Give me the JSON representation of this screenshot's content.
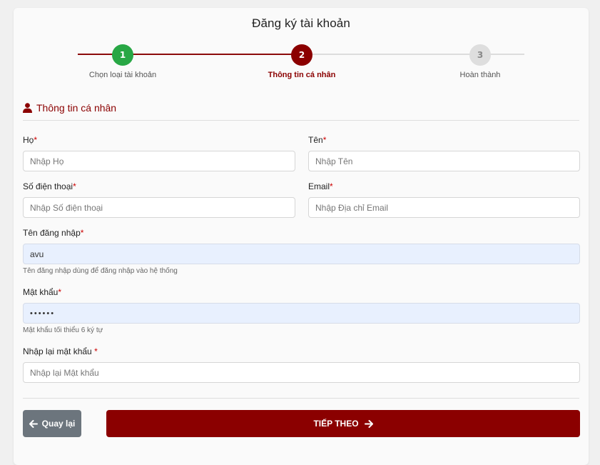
{
  "page": {
    "title": "Đăng ký tài khoản"
  },
  "stepper": {
    "steps": [
      {
        "number": "1",
        "label": "Chọn loại tài khoản",
        "state": "done"
      },
      {
        "number": "2",
        "label": "Thông tin cá nhân",
        "state": "active"
      },
      {
        "number": "3",
        "label": "Hoàn thành",
        "state": "pending"
      }
    ]
  },
  "section": {
    "title": "Thông tin cá nhân",
    "icon": "user-icon"
  },
  "form": {
    "last_name": {
      "label": "Họ",
      "required_mark": "*",
      "placeholder": "Nhập Họ",
      "value": ""
    },
    "first_name": {
      "label": "Tên",
      "required_mark": "*",
      "placeholder": "Nhập Tên",
      "value": ""
    },
    "phone": {
      "label": "Số điện thoại",
      "required_mark": "*",
      "placeholder": "Nhập Số điện thoại",
      "value": ""
    },
    "email": {
      "label": "Email",
      "required_mark": "*",
      "placeholder": "Nhập Địa chỉ Email",
      "value": ""
    },
    "username": {
      "label": "Tên đăng nhập",
      "required_mark": "*",
      "value": "avu",
      "hint": "Tên đăng nhập dùng để đăng nhập vào hệ thống"
    },
    "password": {
      "label": "Mật khẩu",
      "required_mark": "*",
      "value": "••••••",
      "hint": "Mật khẩu tối thiểu 6 ký tự"
    },
    "confirm_password": {
      "label": "Nhập lại mật khẩu",
      "required_mark": " *",
      "placeholder": "Nhập lại Mật khẩu",
      "value": ""
    }
  },
  "actions": {
    "back_label": "Quay lại",
    "next_label": "TIẾP THEO"
  },
  "colors": {
    "primary": "#8b0000",
    "success": "#28a745",
    "secondary": "#6c757d",
    "autofill": "#e8f0fe"
  }
}
